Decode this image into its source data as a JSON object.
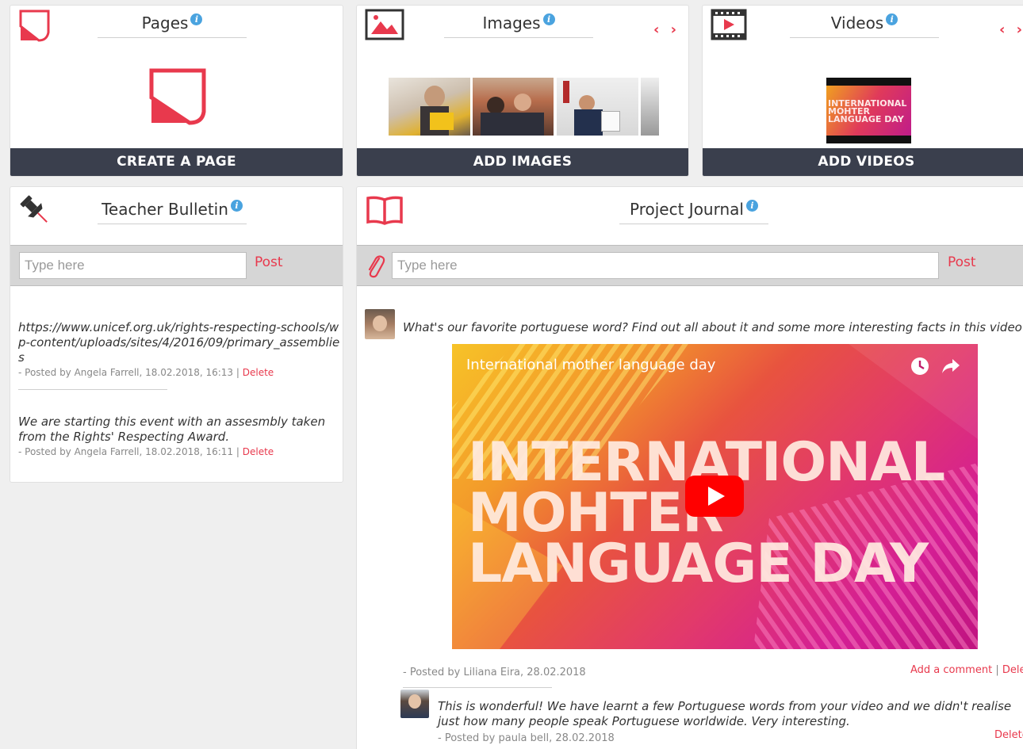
{
  "pages": {
    "title": "Pages",
    "action": "CREATE A PAGE",
    "info": "i"
  },
  "images": {
    "title": "Images",
    "action": "ADD IMAGES",
    "info": "i",
    "nav": "‹ ›"
  },
  "videos": {
    "title": "Videos",
    "action": "ADD VIDEOS",
    "info": "i",
    "nav": "‹ ›",
    "thumb_text": [
      "INTERNATIONAL",
      "MOHTER",
      "LANGUAGE DAY"
    ]
  },
  "bulletin": {
    "title": "Teacher Bulletin",
    "info": "i",
    "placeholder": "Type here",
    "post_label": "Post",
    "posts": [
      {
        "text": "https://www.unicef.org.uk/rights-respecting-schools/wp-content/uploads/sites/4/2016/09/primary_assemblies",
        "meta": "- Posted by Angela Farrell, 18.02.2018, 16:13 |",
        "delete": "Delete"
      },
      {
        "text": "We are starting this event with an assesmbly taken from the Rights' Respecting Award.",
        "meta": "- Posted by Angela Farrell, 18.02.2018, 16:11 |",
        "delete": "Delete"
      }
    ]
  },
  "journal": {
    "title": "Project Journal",
    "info": "i",
    "placeholder": "Type here",
    "post_label": "Post",
    "entry": {
      "text": "What's our favorite portuguese word? Find out all about it and some more interesting facts in this video!",
      "video_title": "International mother language day",
      "video_lines": [
        "INTERNATIONAL",
        "MOHTER",
        "LANGUAGE DAY"
      ],
      "meta": "- Posted by Liliana Eira, 28.02.2018",
      "add_comment": "Add a comment",
      "sep": "|",
      "delete": "Delete"
    },
    "comment": {
      "text": "This is wonderful! We have learnt a few Portuguese words from your video and we didn't realise just how many people speak Portuguese worldwide. Very interesting.",
      "meta": "- Posted by paula bell, 28.02.2018",
      "delete": "Delete"
    }
  },
  "colors": {
    "accent": "#e8394d",
    "bar": "#3a3f4d",
    "info": "#4aa3df"
  }
}
